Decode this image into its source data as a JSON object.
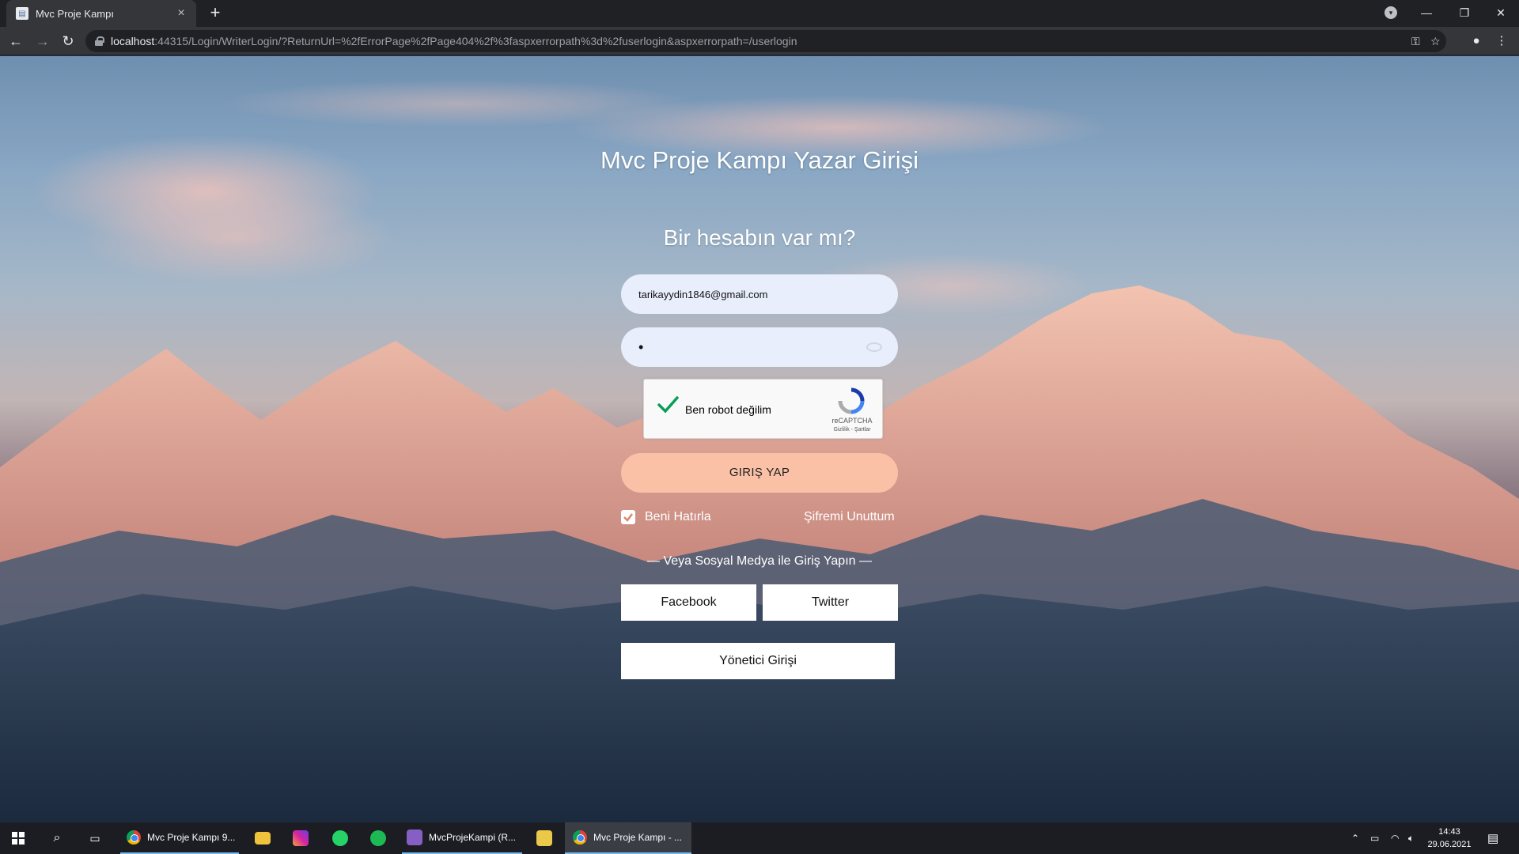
{
  "browser": {
    "tab_title": "Mvc Proje Kampı",
    "url_host": "localhost",
    "url_rest": ":44315/Login/WriterLogin/?ReturnUrl=%2fErrorPage%2fPage404%2f%3faspxerrorpath%3d%2fuserlogin&aspxerrorpath=/userlogin"
  },
  "page": {
    "title": "Mvc Proje Kampı Yazar Girişi",
    "subtitle": "Bir hesabın var mı?",
    "email_value": "tarikayydin1846@gmail.com",
    "password_mask": "•",
    "captcha": {
      "label": "Ben robot değilim",
      "brand": "reCAPTCHA",
      "terms": "Gizlilik - Şartlar"
    },
    "login_button": "GIRIŞ YAP",
    "remember_label": "Beni Hatırla",
    "remember_checked": true,
    "forgot_label": "Şifremi Unuttum",
    "social_divider": "— Veya Sosyal Medya ile Giriş Yapın —",
    "facebook_button": "Facebook",
    "twitter_button": "Twitter",
    "admin_button": "Yönetici Girişi"
  },
  "taskbar": {
    "items": [
      {
        "label": "Mvc Proje Kampı 9..."
      },
      {
        "label": "MvcProjeKampi (R..."
      },
      {
        "label": "Mvc Proje Kampı - ..."
      }
    ],
    "time": "14:43",
    "date": "29.06.2021"
  },
  "colors": {
    "login_button": "#fbc1a6",
    "input_bg": "#e8eefb",
    "taskbar": "#1b1d23",
    "chrome_tabbar": "#202124",
    "chrome_toolbar": "#35363a"
  }
}
